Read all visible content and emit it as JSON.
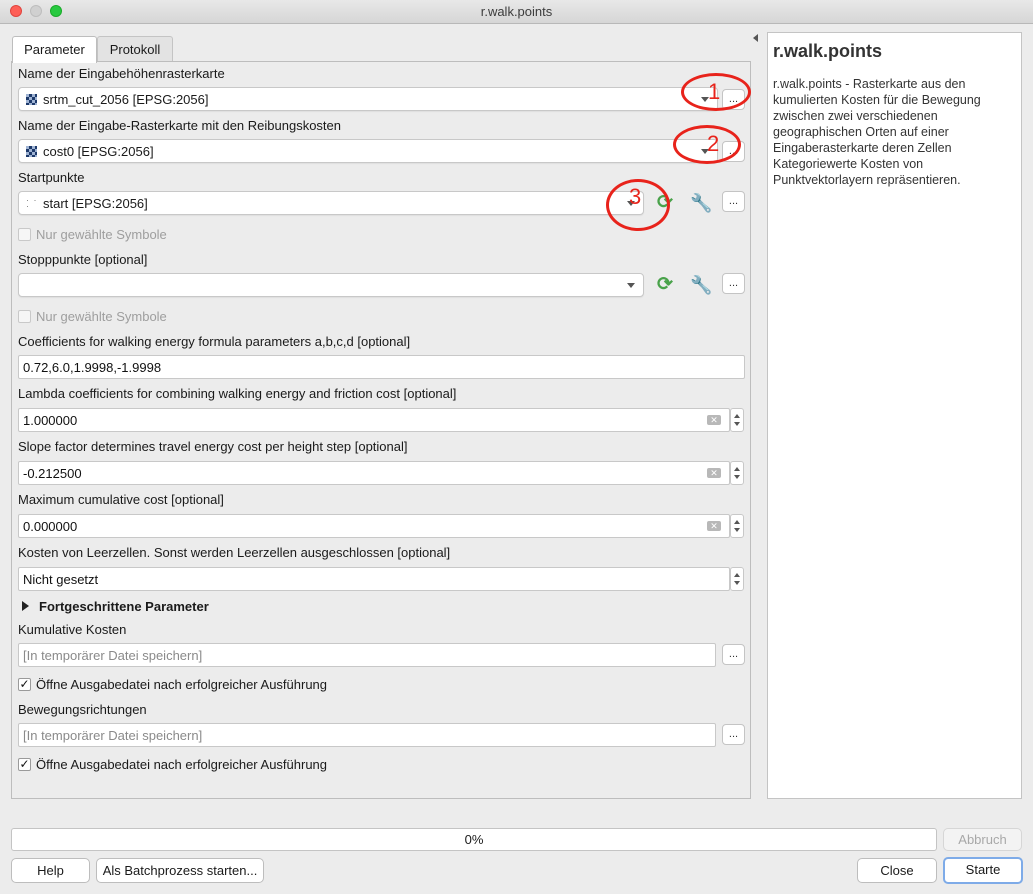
{
  "window": {
    "title": "r.walk.points"
  },
  "tabs": [
    {
      "label": "Parameter"
    },
    {
      "label": "Protokoll"
    }
  ],
  "params": {
    "elevation": {
      "label": "Name der Eingabehöhenrasterkarte",
      "value": "srtm_cut_2056 [EPSG:2056]",
      "icon": "raster-icon"
    },
    "friction": {
      "label": "Name der Eingabe-Rasterkarte mit den Reibungskosten",
      "value": "cost0 [EPSG:2056]",
      "icon": "raster-icon"
    },
    "start": {
      "label": "Startpunkte",
      "value": "start [EPSG:2056]",
      "icon": "point-layer-icon",
      "selected_only": "Nur gewählte Symbole"
    },
    "stop": {
      "label": "Stopppunkte [optional]",
      "value": "",
      "selected_only": "Nur gewählte Symbole"
    },
    "walk_coeff": {
      "label": "Coefficients for walking energy formula parameters a,b,c,d [optional]",
      "value": "0.72,6.0,1.9998,-1.9998"
    },
    "lambda": {
      "label": "Lambda coefficients for combining walking energy and friction cost [optional]",
      "value": "1.000000"
    },
    "slope": {
      "label": "Slope factor determines travel energy cost per height step [optional]",
      "value": "-0.212500"
    },
    "max_cost": {
      "label": "Maximum cumulative cost [optional]",
      "value": "0.000000"
    },
    "null_cost": {
      "label": "Kosten von Leerzellen. Sonst werden Leerzellen ausgeschlossen [optional]",
      "value": "Nicht gesetzt"
    },
    "advanced": {
      "label": "Fortgeschrittene Parameter"
    },
    "cumulative": {
      "label": "Kumulative Kosten",
      "placeholder": "[In temporärer Datei speichern]",
      "open_after": "Öffne Ausgabedatei nach erfolgreicher Ausführung",
      "checked": true
    },
    "movements": {
      "label": "Bewegungsrichtungen",
      "placeholder": "[In temporärer Datei speichern]",
      "open_after": "Öffne Ausgabedatei nach erfolgreicher Ausführung",
      "checked": true
    }
  },
  "annotations": [
    {
      "number": "1"
    },
    {
      "number": "2"
    },
    {
      "number": "3"
    }
  ],
  "annotation_color": "#e8231b",
  "help": {
    "title": "r.walk.points",
    "text": "r.walk.points - Rasterkarte aus den kumulierten Kosten für die Bewegung zwischen zwei verschiedenen geographischen Orten auf einer Eingaberasterkarte deren Zellen Kategoriewerte Kosten von Punktvektorlayern repräsentieren."
  },
  "progress": {
    "label": "0%",
    "value": 0
  },
  "buttons": {
    "abort": "Abbruch",
    "help": "Help",
    "batch": "Als Batchprozess starten...",
    "close": "Close",
    "start": "Starte"
  },
  "dots_label": "..."
}
